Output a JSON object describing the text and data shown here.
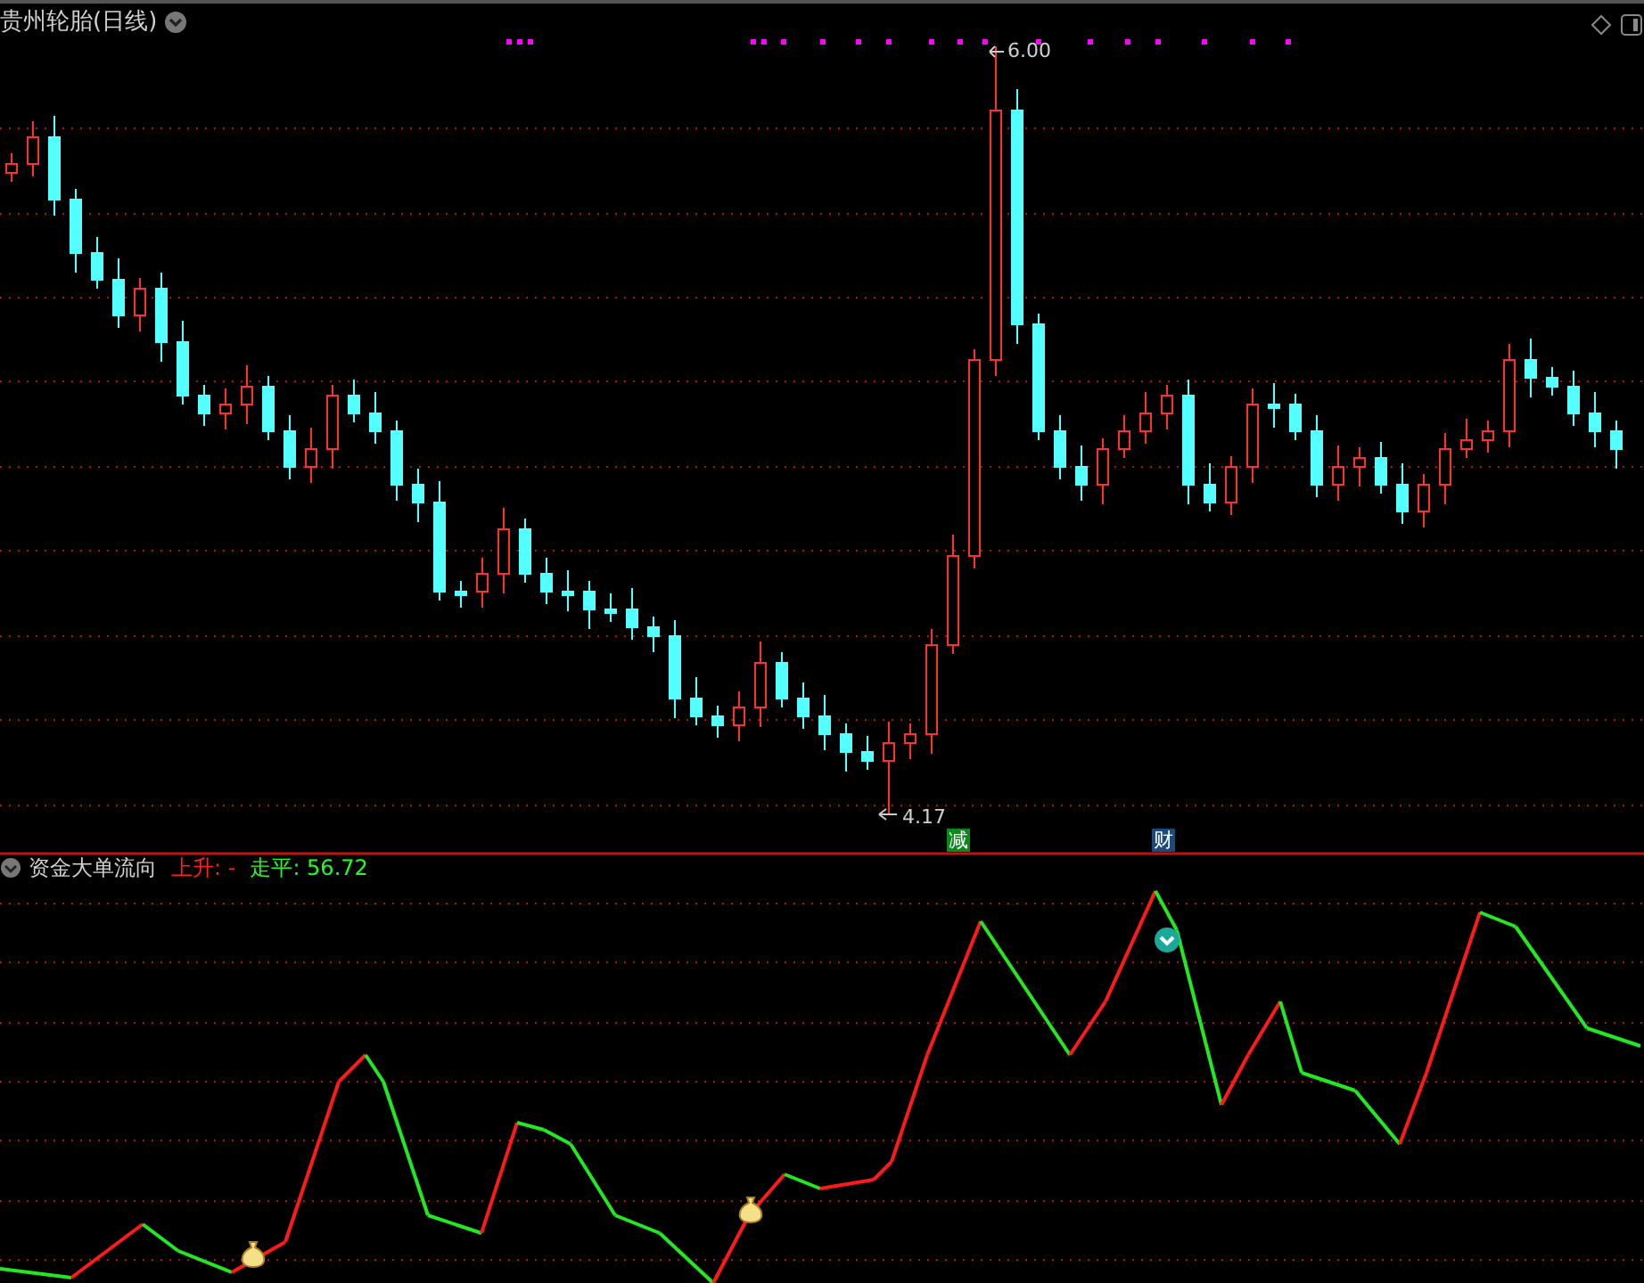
{
  "window": {
    "title": "贵州轮胎(日线)"
  },
  "price_chart": {
    "high_label": "6.00",
    "low_label": "4.17",
    "badges": [
      {
        "text": "减",
        "color": "#0a8a1a"
      },
      {
        "text": "财",
        "color": "#1b4a7a"
      }
    ]
  },
  "indicator": {
    "title": "资金大单流向",
    "readings": [
      {
        "label": "上升:",
        "value": "-",
        "color": "#ff2020"
      },
      {
        "label": "走平:",
        "value": "56.72",
        "color": "#20ff20"
      }
    ]
  }
}
